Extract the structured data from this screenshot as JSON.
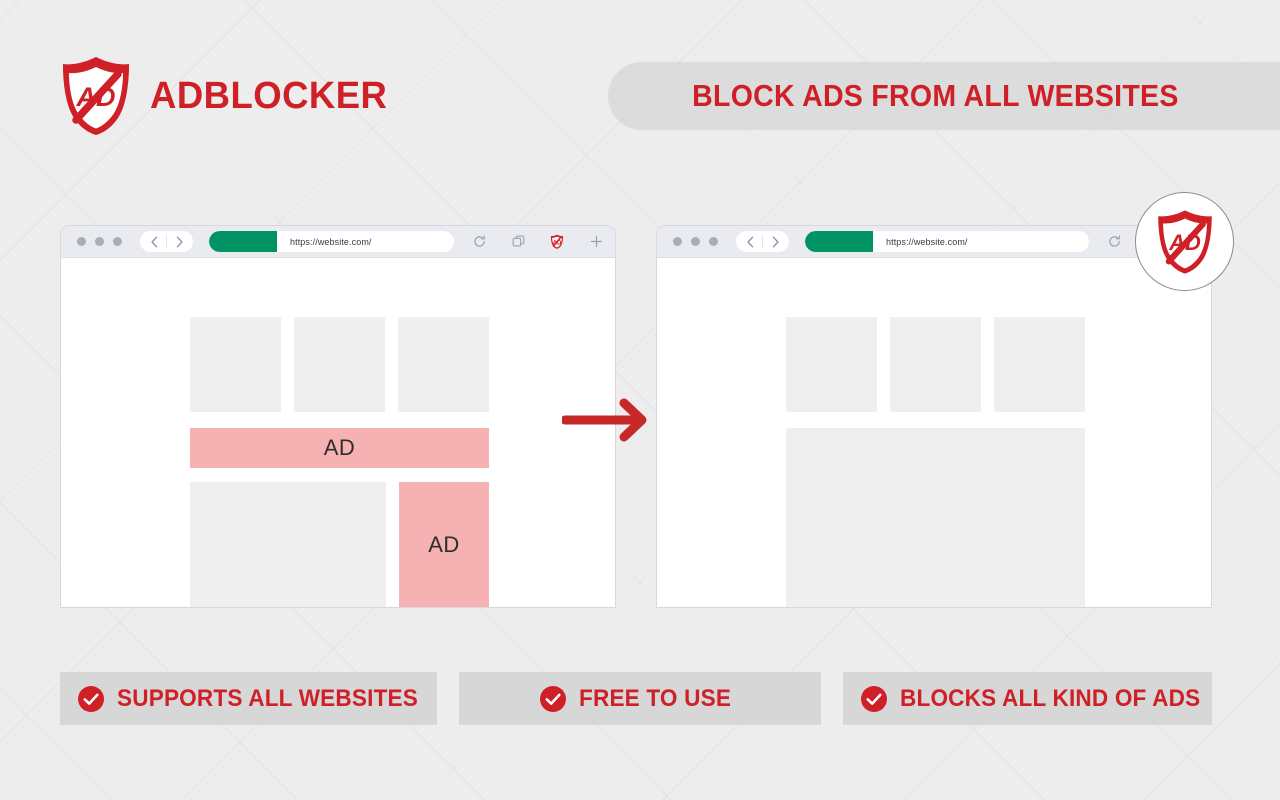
{
  "brand": {
    "name": "ADBLOCKER",
    "logo_icon": "shield-ad-blocked-icon",
    "accent_color": "#cf2027"
  },
  "headline": {
    "text": "BLOCK ADS FROM ALL WEBSITES"
  },
  "browsers": [
    {
      "id": "before",
      "url": "https://website.com/",
      "window_dots_icon": "window-dots-icon",
      "back_icon": "chevron-left-icon",
      "forward_icon": "chevron-right-icon",
      "reload_icon": "reload-icon",
      "tabs_icon": "duplicate-tab-icon",
      "shield_icon": "shield-ad-icon",
      "new_tab_icon": "plus-icon",
      "ads": [
        {
          "label": "AD",
          "slot": "banner"
        },
        {
          "label": "AD",
          "slot": "sidebar"
        }
      ]
    },
    {
      "id": "after",
      "url": "https://website.com/",
      "window_dots_icon": "window-dots-icon",
      "back_icon": "chevron-left-icon",
      "forward_icon": "chevron-right-icon",
      "reload_icon": "reload-icon",
      "ads": []
    }
  ],
  "arrow": {
    "icon": "arrow-right-icon",
    "color": "#c62828"
  },
  "badge": {
    "icon": "shield-ad-blocked-icon"
  },
  "features": [
    {
      "label": "SUPPORTS ALL WEBSITES",
      "icon": "check-circle-icon"
    },
    {
      "label": "FREE TO USE",
      "icon": "check-circle-icon"
    },
    {
      "label": "BLOCKS ALL KIND OF ADS",
      "icon": "check-circle-icon"
    }
  ],
  "colors": {
    "background": "#ededed",
    "brand_red": "#cf2027",
    "ad_pink": "#f6b2b2",
    "placeholder_gray": "#efefef",
    "url_green": "#009463",
    "bar_gray": "#c8c8c8"
  }
}
